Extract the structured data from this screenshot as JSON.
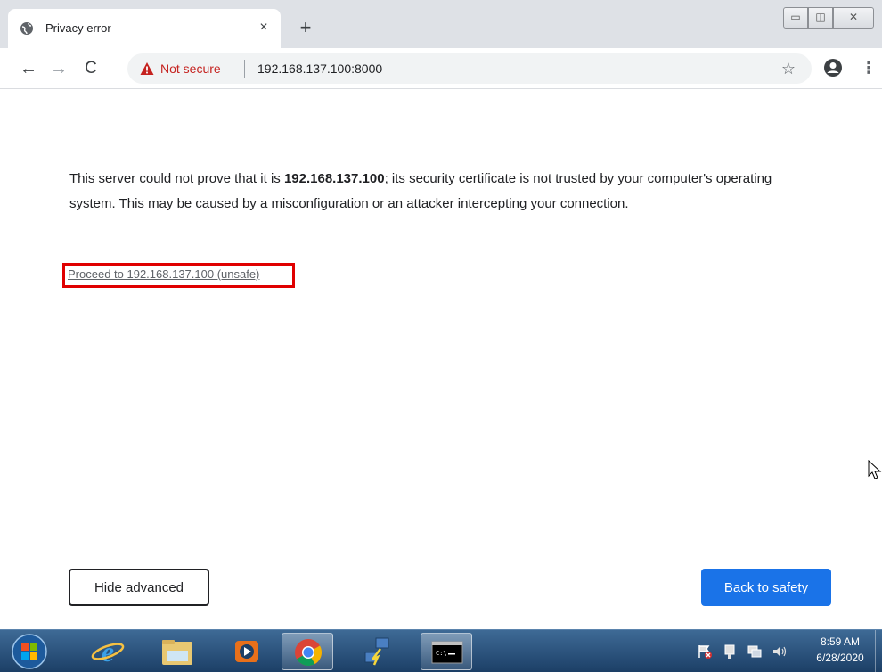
{
  "tab": {
    "title": "Privacy error",
    "close_glyph": "×",
    "new_tab_glyph": "+"
  },
  "window_controls": {
    "minimize_glyph": "▭",
    "maximize_glyph": "◫",
    "close_glyph": "✕"
  },
  "toolbar": {
    "back_glyph": "←",
    "forward_glyph": "→",
    "reload_glyph": "C",
    "security_label": "Not secure",
    "url": "192.168.137.100:8000",
    "star_glyph": "☆",
    "menu_glyph": "⋮"
  },
  "page": {
    "message_pre": "This server could not prove that it is ",
    "message_host": "192.168.137.100",
    "message_post": "; its security certificate is not trusted by your computer's operating system. This may be caused by a misconfiguration or an attacker intercepting your connection.",
    "proceed_link": "Proceed to 192.168.137.100 (unsafe)",
    "hide_advanced": "Hide advanced",
    "back_to_safety": "Back to safety"
  },
  "taskbar": {
    "apps": [
      "internet-explorer",
      "file-explorer",
      "media-player",
      "chrome",
      "network-tool",
      "command-prompt"
    ],
    "active_app": "chrome",
    "clock_time": "8:59 AM",
    "clock_date": "6/28/2020"
  },
  "colors": {
    "tab_strip": "#dee1e6",
    "not_secure_red": "#c5221f",
    "primary_button": "#1a73e8",
    "highlight_box": "#e00000",
    "taskbar": "#1c3f66"
  }
}
